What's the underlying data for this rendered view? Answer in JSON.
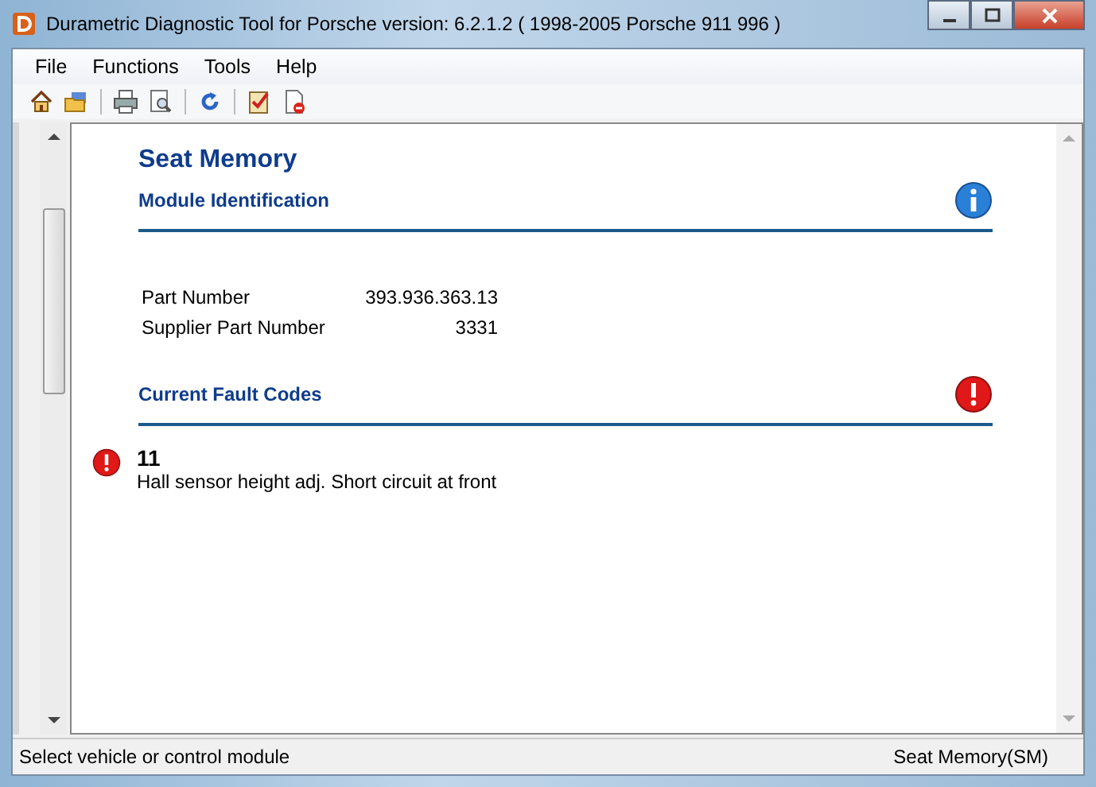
{
  "window": {
    "title": "Durametric Diagnostic Tool for Porsche version: 6.2.1.2  ( 1998-2005 Porsche 911 996 )"
  },
  "menu": [
    "File",
    "Functions",
    "Tools",
    "Help"
  ],
  "toolbar": [
    {
      "kind": "home"
    },
    {
      "kind": "open"
    },
    {
      "kind": "sep"
    },
    {
      "kind": "print"
    },
    {
      "kind": "preview"
    },
    {
      "kind": "sep"
    },
    {
      "kind": "refresh"
    },
    {
      "kind": "sep"
    },
    {
      "kind": "check"
    },
    {
      "kind": "delete"
    }
  ],
  "module": {
    "title": "Seat Memory",
    "section": "Module Identification",
    "rows": [
      {
        "label": "Part Number",
        "value": "393.936.363.13"
      },
      {
        "label": "Supplier Part Number",
        "value": "3331"
      }
    ]
  },
  "faults": {
    "section": "Current Fault Codes",
    "items": [
      {
        "code": "11",
        "text": "Hall sensor height adj. Short circuit at front"
      }
    ]
  },
  "status_bar": {
    "left": "Select vehicle or control module",
    "right": "Seat Memory(SM)"
  }
}
